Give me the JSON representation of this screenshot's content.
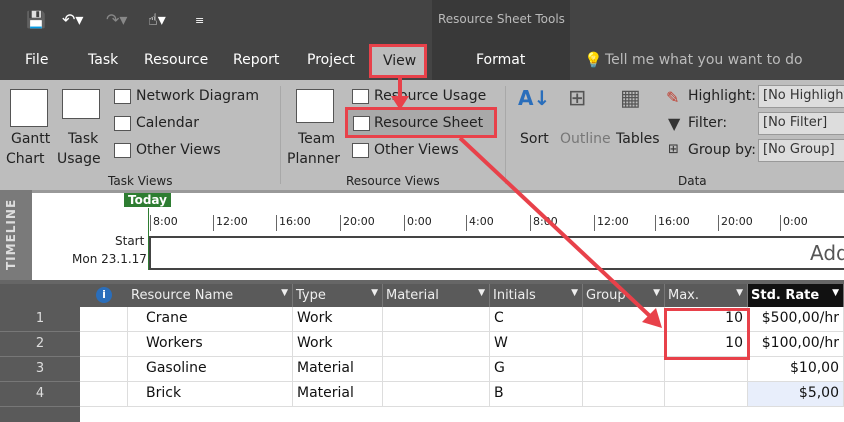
{
  "qat": {
    "save": "save-icon",
    "undo": "undo-icon",
    "redo": "redo-icon",
    "touch": "touch-mode-icon",
    "customize": "customize-icon"
  },
  "context_title": "Resource Sheet Tools",
  "tabs": [
    "File",
    "Task",
    "Resource",
    "Report",
    "Project",
    "View",
    "Format"
  ],
  "tell_me": "Tell me what you want to do",
  "ribbon": {
    "task_views": {
      "label": "Task Views",
      "gantt": [
        "Gantt",
        "Chart"
      ],
      "usage": [
        "Task",
        "Usage"
      ],
      "network": "Network Diagram",
      "calendar": "Calendar",
      "other": "Other Views"
    },
    "resource_views": {
      "label": "Resource Views",
      "team": [
        "Team",
        "Planner"
      ],
      "usage": "Resource Usage",
      "sheet": "Resource Sheet",
      "other": "Other Views"
    },
    "data": {
      "label": "Data",
      "sort": "Sort",
      "outline": "Outline",
      "tables": "Tables",
      "highlight_label": "Highlight:",
      "highlight_value": "[No Highlight]",
      "filter_label": "Filter:",
      "filter_value": "[No Filter]",
      "group_label": "Group by:",
      "group_value": "[No Group]"
    }
  },
  "timeline": {
    "side": "TIMELINE",
    "today": "Today",
    "start": "Start",
    "start_date": "Mon 23.1.17",
    "ticks": [
      "8:00",
      "12:00",
      "16:00",
      "20:00",
      "0:00",
      "4:00",
      "8:00",
      "12:00",
      "16:00",
      "20:00",
      "0:00"
    ],
    "add": "Add"
  },
  "grid": {
    "columns": [
      "Resource Name",
      "Type",
      "Material",
      "Initials",
      "Group",
      "Max.",
      "Std. Rate"
    ],
    "rows": [
      {
        "n": "1",
        "name": "Crane",
        "type": "Work",
        "material": "",
        "initials": "C",
        "group": "",
        "max": "10",
        "rate": "$500,00/hr"
      },
      {
        "n": "2",
        "name": "Workers",
        "type": "Work",
        "material": "",
        "initials": "W",
        "group": "",
        "max": "10",
        "rate": "$100,00/hr"
      },
      {
        "n": "3",
        "name": "Gasoline",
        "type": "Material",
        "material": "",
        "initials": "G",
        "group": "",
        "max": "",
        "rate": "$10,00"
      },
      {
        "n": "4",
        "name": "Brick",
        "type": "Material",
        "material": "",
        "initials": "B",
        "group": "",
        "max": "",
        "rate": "$5,00"
      }
    ]
  },
  "colors": {
    "annotation": "#e8414a",
    "today": "#2e7d32"
  }
}
